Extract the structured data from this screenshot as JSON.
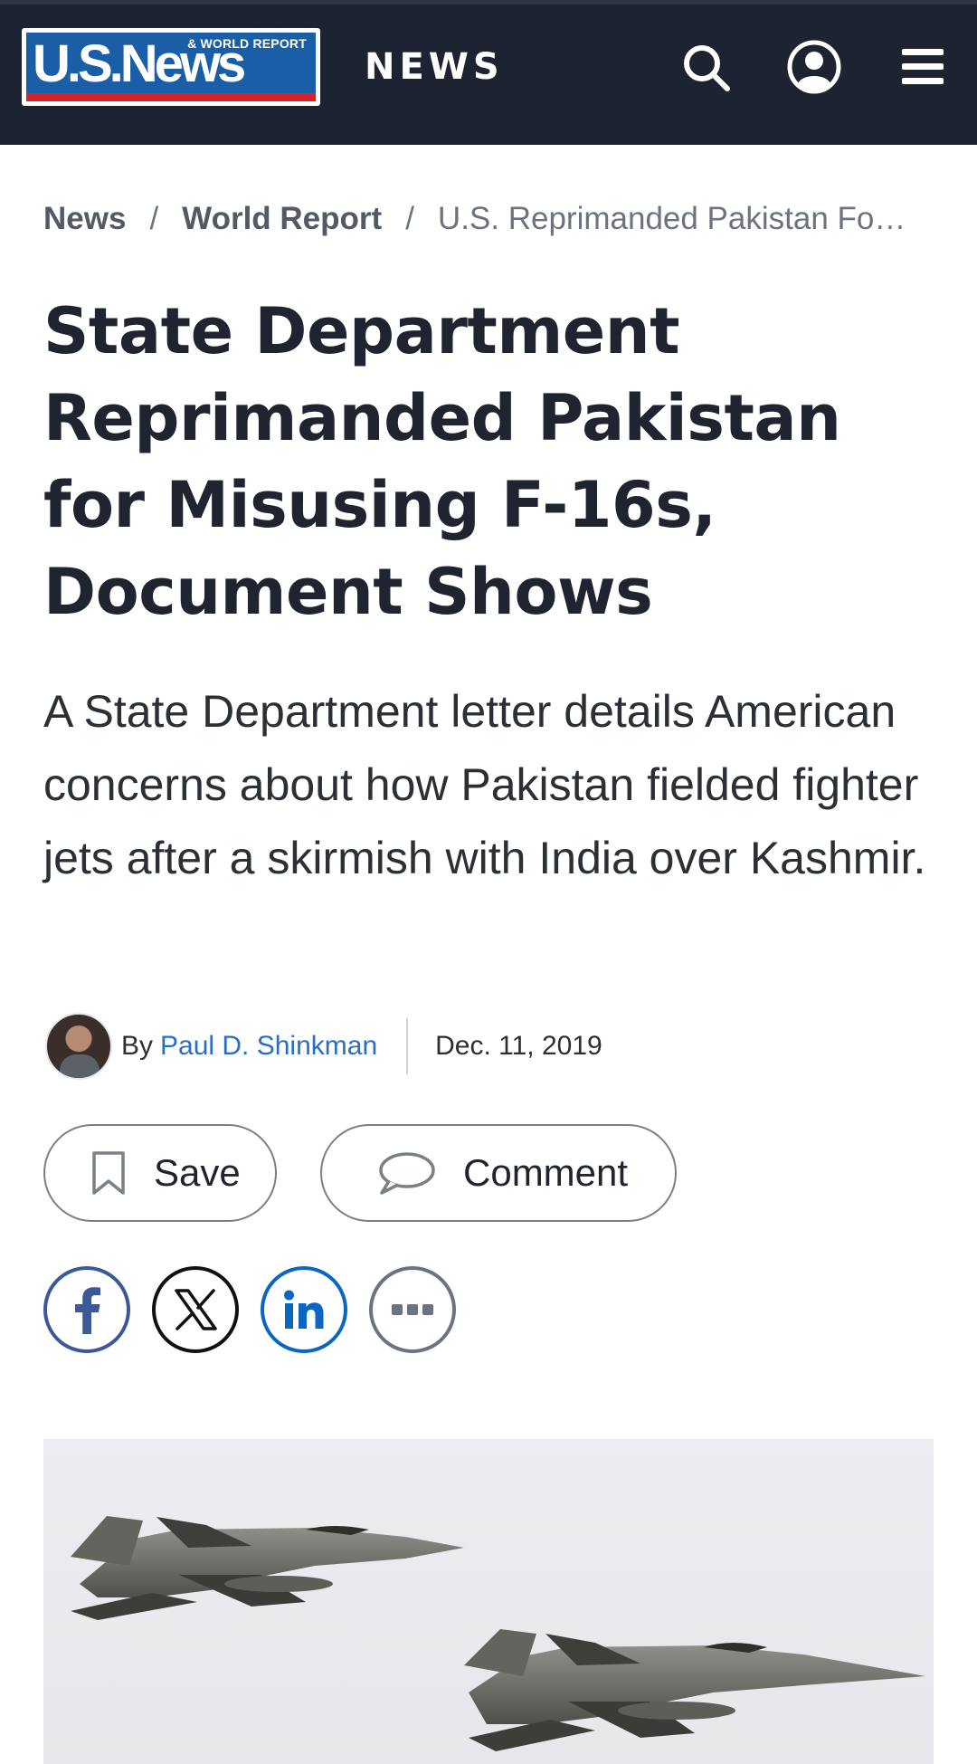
{
  "header": {
    "logo_text": "U.S.News",
    "logo_subtext": "& WORLD REPORT",
    "section_label": "NEWS",
    "icons": [
      "search-icon",
      "account-icon",
      "menu-icon"
    ],
    "background_color": "#1d2330"
  },
  "breadcrumb": {
    "items": [
      {
        "label": "News"
      },
      {
        "label": "World Report"
      }
    ],
    "separator": "/",
    "current": "U.S. Reprimanded Pakistan Fo…"
  },
  "article": {
    "headline": "State Department Reprimanded Pakistan for Misusing F-16s, Document Shows",
    "dek": "A State Department letter details American concerns about how Pakistan fielded fighter jets after a skirmish with India over Kashmir.",
    "byline": {
      "prefix": "By",
      "author": "Paul D. Shinkman",
      "date": "Dec. 11, 2019",
      "author_link_color": "#2a6ec2"
    },
    "actions": {
      "save_label": "Save",
      "comment_label": "Comment"
    },
    "share": {
      "icons": [
        "facebook-icon",
        "x-icon",
        "linkedin-icon",
        "more-icon"
      ]
    },
    "hero_image": {
      "subject": "fighter-jets"
    }
  }
}
